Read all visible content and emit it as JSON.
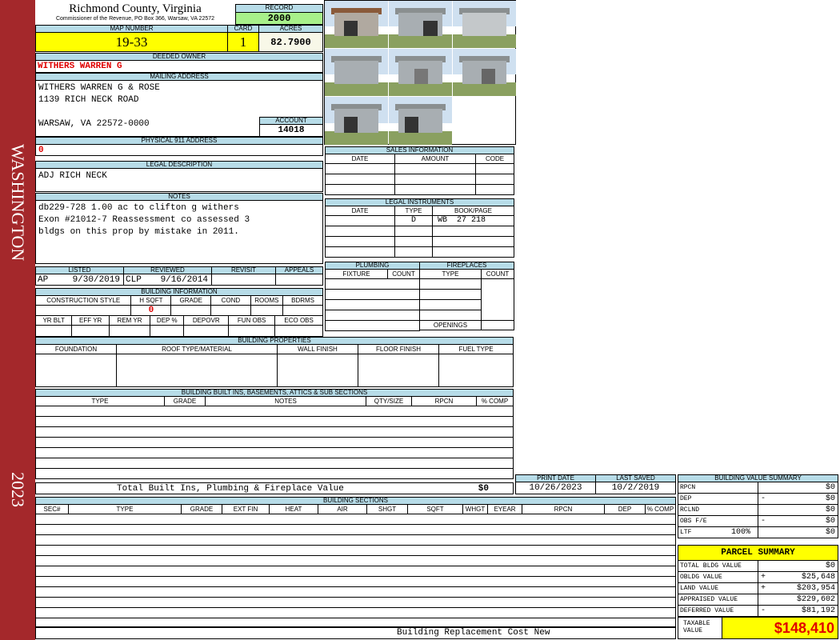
{
  "sidebar": {
    "district": "WASHINGTON",
    "year": "2023"
  },
  "header": {
    "county": "Richmond County, Virginia",
    "commissioner": "Commissioner of the Revenue, PO Box 366, Warsaw, VA 22572",
    "record_label": "RECORD",
    "record_value": "2000",
    "map_label": "MAP NUMBER",
    "map_value": "19-33",
    "card_label": "CARD",
    "card_value": "1",
    "acres_label": "ACRES",
    "acres_value": "82.7900"
  },
  "owner": {
    "label": "DEEDED OWNER",
    "value": "WITHERS WARREN G"
  },
  "mailing": {
    "label": "MAILING ADDRESS",
    "line1": "WITHERS WARREN G & ROSE",
    "line2": "1139 RICH NECK ROAD",
    "line3": "WARSAW, VA 22572-0000",
    "account_label": "ACCOUNT",
    "account_value": "14018"
  },
  "physical": {
    "label": "PHYSICAL 911 ADDRESS",
    "value": "0"
  },
  "legal": {
    "label": "LEGAL DESCRIPTION",
    "value": "ADJ RICH NECK"
  },
  "notes": {
    "label": "NOTES",
    "line1": "db229-728 1.00 ac to clifton g withers",
    "line2": "Exon #21012-7 Reassessment co assessed 3",
    "line3": "bldgs on this prop by mistake in 2011."
  },
  "status": {
    "listed_label": "LISTED",
    "listed_by": "AP",
    "listed_date": "9/30/2019",
    "reviewed_label": "REVIEWED",
    "reviewed_by": "CLP",
    "reviewed_date": "9/16/2014",
    "revisit_label": "REVISIT",
    "appeals_label": "APPEALS"
  },
  "building_info": {
    "label": "BUILDING INFORMATION",
    "cols": [
      "CONSTRUCTION STYLE",
      "H SQFT",
      "GRADE",
      "COND",
      "ROOMS",
      "BDRMS"
    ],
    "hsqft": "0",
    "cols2": [
      "YR BLT",
      "EFF YR",
      "REM YR",
      "DEP %",
      "DEPOVR",
      "FUN OBS",
      "ECO OBS"
    ]
  },
  "sales": {
    "label": "SALES INFORMATION",
    "cols": [
      "DATE",
      "AMOUNT",
      "CODE"
    ]
  },
  "instruments": {
    "label": "LEGAL INSTRUMENTS",
    "cols": [
      "DATE",
      "TYPE",
      "BOOK/PAGE"
    ],
    "type": "D",
    "book": "WB",
    "page": "27 218"
  },
  "plumbing": {
    "label": "PLUMBING",
    "cols": [
      "FIXTURE",
      "COUNT"
    ]
  },
  "fireplaces": {
    "label": "FIREPLACES",
    "cols": [
      "TYPE",
      "COUNT"
    ],
    "openings": "OPENINGS"
  },
  "properties": {
    "label": "BUILDING PROPERTIES",
    "cols": [
      "FOUNDATION",
      "ROOF TYPE/MATERIAL",
      "WALL FINISH",
      "FLOOR FINISH",
      "FUEL TYPE"
    ]
  },
  "builtins": {
    "label": "BUILDING BUILT INS, BASEMENTS, ATTICS & SUB SECTIONS",
    "cols": [
      "TYPE",
      "GRADE",
      "NOTES",
      "QTY/SIZE",
      "RPCN",
      "% COMP"
    ],
    "total_label": "Total Built Ins, Plumbing & Fireplace Value",
    "total_value": "$0"
  },
  "dates": {
    "print_label": "PRINT DATE",
    "print_value": "10/26/2023",
    "saved_label": "LAST SAVED",
    "saved_value": "10/2/2019"
  },
  "sections": {
    "label": "BUILDING SECTIONS",
    "cols": [
      "SEC#",
      "TYPE",
      "GRADE",
      "EXT FIN",
      "HEAT",
      "AIR",
      "SHGT",
      "SQFT",
      "WHGT",
      "EYEAR",
      "RPCN",
      "DEP",
      "% COMP"
    ],
    "footer": "Building Replacement Cost New"
  },
  "value_summary": {
    "label": "BUILDING VALUE SUMMARY",
    "rows": [
      {
        "label": "RPCN",
        "sign": "",
        "value": "$0"
      },
      {
        "label": "DEP",
        "sign": "-",
        "value": "$0"
      },
      {
        "label": "RCLND",
        "sign": "",
        "value": "$0"
      },
      {
        "label": "OBS F/E",
        "sign": "-",
        "value": "$0"
      },
      {
        "label": "LTF",
        "sign": "100%",
        "value": "$0"
      }
    ]
  },
  "parcel": {
    "title": "PARCEL SUMMARY",
    "rows": [
      {
        "label": "TOTAL BLDG VALUE",
        "sign": "",
        "value": "$0"
      },
      {
        "label": "OBLDG VALUE",
        "sign": "+",
        "value": "$25,648"
      },
      {
        "label": "LAND VALUE",
        "sign": "+",
        "value": "$203,954"
      },
      {
        "label": "APPRAISED VALUE",
        "sign": "",
        "value": "$229,602"
      },
      {
        "label": "DEFERRED VALUE",
        "sign": "-",
        "value": "$81,192"
      }
    ],
    "taxable_label1": "TAXABLE",
    "taxable_label2": "VALUE",
    "taxable_value": "$148,410"
  },
  "colors": {
    "sidebar": "#a4282b",
    "header": "#b7dce8",
    "highlight": "#ffff00",
    "record": "#a8f08a",
    "alert": "#e00000"
  }
}
